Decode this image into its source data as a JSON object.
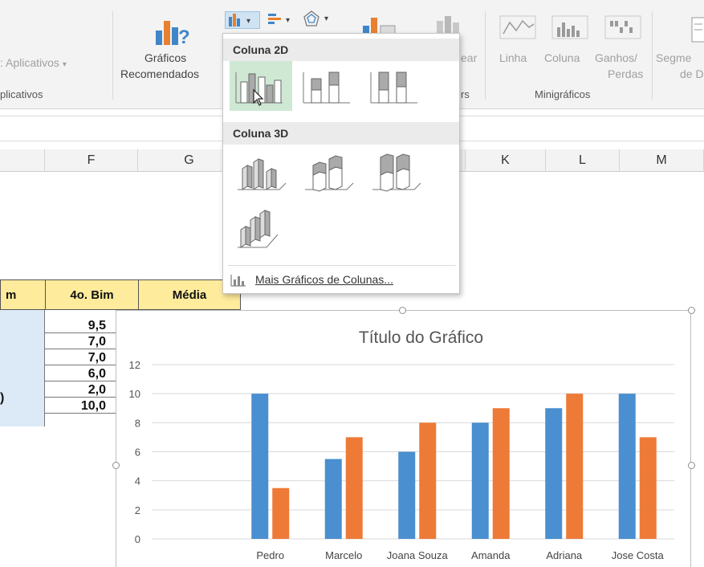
{
  "ribbon": {
    "aplicativos_label": ": Aplicativos",
    "aplicativos_group": "plicativos",
    "graficos_line1": "Gráficos",
    "graficos_line2": "Recomendados",
    "minigraficos_group": "Minigráficos",
    "hidden_label_fragment": "ear",
    "hidden_group_fragment": "rs",
    "linha_label": "Linha",
    "coluna_label": "Coluna",
    "ganhos_line1": "Ganhos/",
    "ganhos_line2": "Perdas",
    "segm_line1": "Segme",
    "segm_line2": "de D"
  },
  "columns": [
    "F",
    "G",
    "K",
    "L",
    "M"
  ],
  "dropdown": {
    "section_2d": "Coluna 2D",
    "section_3d": "Coluna 3D",
    "more_link": "Mais Gráficos de Colunas..."
  },
  "table": {
    "headers": [
      "m",
      "4o. Bim",
      "Média"
    ],
    "values": [
      "9,5",
      "7,0",
      "7,0",
      "6,0",
      "2,0",
      "10,0"
    ],
    "left_fragment": ")"
  },
  "chart_data": {
    "type": "bar",
    "title": "Título do Gráfico",
    "categories": [
      "Pedro",
      "Marcelo",
      "Joana Souza",
      "Amanda",
      "Adriana",
      "Jose Costa"
    ],
    "series": [
      {
        "values": [
          10,
          5.5,
          6,
          8,
          9,
          10
        ]
      },
      {
        "values": [
          3.5,
          7,
          8,
          9,
          10,
          7
        ]
      }
    ],
    "colors": [
      "#4a8fcf",
      "#ee7a37"
    ],
    "ylim": [
      0,
      12
    ],
    "yticks": [
      0,
      2,
      4,
      6,
      8,
      10,
      12
    ],
    "grid": true
  }
}
